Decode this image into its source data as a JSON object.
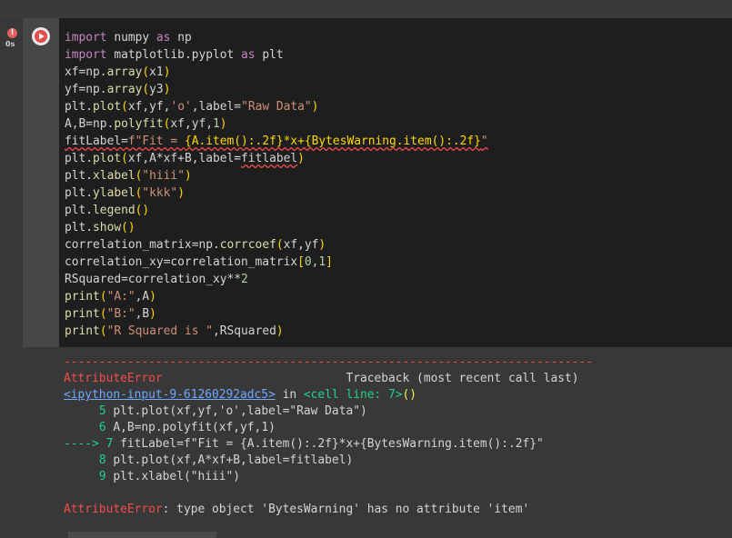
{
  "cell": {
    "status_glyph": "!",
    "exec_time": "0s",
    "run_label": "Run cell",
    "code": [
      [
        "import",
        " numpy ",
        "as",
        " np"
      ],
      [
        "import",
        " matplotlib.pyplot ",
        "as",
        " plt"
      ],
      [
        "xf=np.",
        "array",
        "(",
        "x1",
        ")"
      ],
      [
        "yf=np.",
        "array",
        "(",
        "y3",
        ")"
      ],
      [
        "plt.",
        "plot",
        "(",
        "xf,yf,",
        "'o'",
        ",label=",
        "\"Raw Data\"",
        ")"
      ],
      [
        "A,B=np.",
        "polyfit",
        "(",
        "xf,yf,",
        "1",
        ")"
      ],
      [
        "fitLabel=",
        "f\"Fit = ",
        "{A.item():.2f}*x+{BytesWarning.item():.2f}",
        "\""
      ],
      [
        "plt.",
        "plot",
        "(",
        "xf,A*xf+B,label=",
        "fitlabel",
        ")"
      ],
      [
        "plt.",
        "xlabel",
        "(",
        "\"hiii\"",
        ")"
      ],
      [
        "plt.",
        "ylabel",
        "(",
        "\"kkk\"",
        ")"
      ],
      [
        "plt.",
        "legend",
        "(",
        ")"
      ],
      [
        "plt.",
        "show",
        "(",
        ")"
      ],
      [
        "correlation_matrix=np.",
        "corrcoef",
        "(",
        "xf,yf",
        ")"
      ],
      [
        "correlation_xy=correlation_matrix",
        "[",
        "0",
        ",",
        "1",
        "]"
      ],
      [
        "RSquared=correlation_xy**",
        "2"
      ],
      [
        "print",
        "(",
        "\"A:\"",
        ",A",
        ")"
      ],
      [
        "print",
        "(",
        "\"B:\"",
        ",B",
        ")"
      ],
      [
        "print",
        "(",
        "\"R Squared is \"",
        ",RSquared",
        ")"
      ]
    ]
  },
  "output": {
    "divider": "---------------------------------------------------------------------------",
    "error_name": "AttributeError",
    "traceback_label": "Traceback (most recent call last)",
    "input_link": "<ipython-input-9-61260292adc5>",
    "in_text": " in ",
    "cell_line": "<cell line: 7>",
    "parens": "()",
    "lines": [
      {
        "num": "5",
        "arrow": "",
        "code": "plt.plot(xf,yf,'o',label=\"Raw Data\")"
      },
      {
        "num": "6",
        "arrow": "",
        "code": "A,B=np.polyfit(xf,yf,1)"
      },
      {
        "num": "7",
        "arrow": "---->",
        "code": "fitLabel=f\"Fit = {A.item():.2f}*x+{BytesWarning.item():.2f}\""
      },
      {
        "num": "8",
        "arrow": "",
        "code": "plt.plot(xf,A*xf+B,label=fitlabel)"
      },
      {
        "num": "9",
        "arrow": "",
        "code": "plt.xlabel(\"hiii\")"
      }
    ],
    "final_error_name": "AttributeError",
    "final_message": ": type object 'BytesWarning' has no attribute 'item'"
  }
}
